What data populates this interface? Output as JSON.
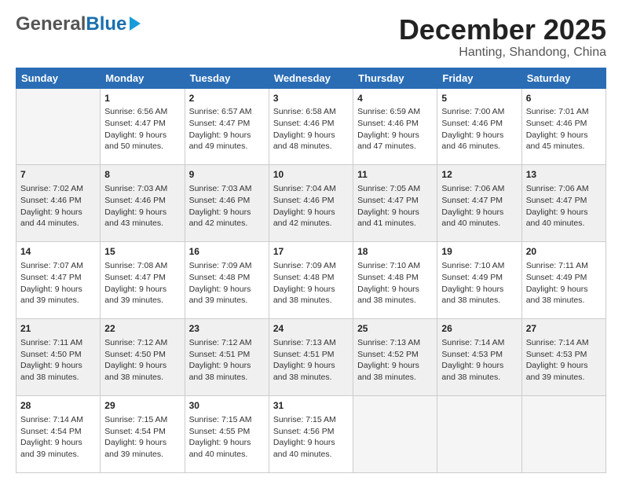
{
  "logo": {
    "general": "General",
    "blue": "Blue",
    "tagline": "GeneralBlue"
  },
  "header": {
    "month": "December 2025",
    "location": "Hanting, Shandong, China"
  },
  "days_of_week": [
    "Sunday",
    "Monday",
    "Tuesday",
    "Wednesday",
    "Thursday",
    "Friday",
    "Saturday"
  ],
  "weeks": [
    [
      {
        "day": "",
        "content": ""
      },
      {
        "day": "1",
        "content": "Sunrise: 6:56 AM\nSunset: 4:47 PM\nDaylight: 9 hours\nand 50 minutes."
      },
      {
        "day": "2",
        "content": "Sunrise: 6:57 AM\nSunset: 4:47 PM\nDaylight: 9 hours\nand 49 minutes."
      },
      {
        "day": "3",
        "content": "Sunrise: 6:58 AM\nSunset: 4:46 PM\nDaylight: 9 hours\nand 48 minutes."
      },
      {
        "day": "4",
        "content": "Sunrise: 6:59 AM\nSunset: 4:46 PM\nDaylight: 9 hours\nand 47 minutes."
      },
      {
        "day": "5",
        "content": "Sunrise: 7:00 AM\nSunset: 4:46 PM\nDaylight: 9 hours\nand 46 minutes."
      },
      {
        "day": "6",
        "content": "Sunrise: 7:01 AM\nSunset: 4:46 PM\nDaylight: 9 hours\nand 45 minutes."
      }
    ],
    [
      {
        "day": "7",
        "content": "Sunrise: 7:02 AM\nSunset: 4:46 PM\nDaylight: 9 hours\nand 44 minutes."
      },
      {
        "day": "8",
        "content": "Sunrise: 7:03 AM\nSunset: 4:46 PM\nDaylight: 9 hours\nand 43 minutes."
      },
      {
        "day": "9",
        "content": "Sunrise: 7:03 AM\nSunset: 4:46 PM\nDaylight: 9 hours\nand 42 minutes."
      },
      {
        "day": "10",
        "content": "Sunrise: 7:04 AM\nSunset: 4:46 PM\nDaylight: 9 hours\nand 42 minutes."
      },
      {
        "day": "11",
        "content": "Sunrise: 7:05 AM\nSunset: 4:47 PM\nDaylight: 9 hours\nand 41 minutes."
      },
      {
        "day": "12",
        "content": "Sunrise: 7:06 AM\nSunset: 4:47 PM\nDaylight: 9 hours\nand 40 minutes."
      },
      {
        "day": "13",
        "content": "Sunrise: 7:06 AM\nSunset: 4:47 PM\nDaylight: 9 hours\nand 40 minutes."
      }
    ],
    [
      {
        "day": "14",
        "content": "Sunrise: 7:07 AM\nSunset: 4:47 PM\nDaylight: 9 hours\nand 39 minutes."
      },
      {
        "day": "15",
        "content": "Sunrise: 7:08 AM\nSunset: 4:47 PM\nDaylight: 9 hours\nand 39 minutes."
      },
      {
        "day": "16",
        "content": "Sunrise: 7:09 AM\nSunset: 4:48 PM\nDaylight: 9 hours\nand 39 minutes."
      },
      {
        "day": "17",
        "content": "Sunrise: 7:09 AM\nSunset: 4:48 PM\nDaylight: 9 hours\nand 38 minutes."
      },
      {
        "day": "18",
        "content": "Sunrise: 7:10 AM\nSunset: 4:48 PM\nDaylight: 9 hours\nand 38 minutes."
      },
      {
        "day": "19",
        "content": "Sunrise: 7:10 AM\nSunset: 4:49 PM\nDaylight: 9 hours\nand 38 minutes."
      },
      {
        "day": "20",
        "content": "Sunrise: 7:11 AM\nSunset: 4:49 PM\nDaylight: 9 hours\nand 38 minutes."
      }
    ],
    [
      {
        "day": "21",
        "content": "Sunrise: 7:11 AM\nSunset: 4:50 PM\nDaylight: 9 hours\nand 38 minutes."
      },
      {
        "day": "22",
        "content": "Sunrise: 7:12 AM\nSunset: 4:50 PM\nDaylight: 9 hours\nand 38 minutes."
      },
      {
        "day": "23",
        "content": "Sunrise: 7:12 AM\nSunset: 4:51 PM\nDaylight: 9 hours\nand 38 minutes."
      },
      {
        "day": "24",
        "content": "Sunrise: 7:13 AM\nSunset: 4:51 PM\nDaylight: 9 hours\nand 38 minutes."
      },
      {
        "day": "25",
        "content": "Sunrise: 7:13 AM\nSunset: 4:52 PM\nDaylight: 9 hours\nand 38 minutes."
      },
      {
        "day": "26",
        "content": "Sunrise: 7:14 AM\nSunset: 4:53 PM\nDaylight: 9 hours\nand 38 minutes."
      },
      {
        "day": "27",
        "content": "Sunrise: 7:14 AM\nSunset: 4:53 PM\nDaylight: 9 hours\nand 39 minutes."
      }
    ],
    [
      {
        "day": "28",
        "content": "Sunrise: 7:14 AM\nSunset: 4:54 PM\nDaylight: 9 hours\nand 39 minutes."
      },
      {
        "day": "29",
        "content": "Sunrise: 7:15 AM\nSunset: 4:54 PM\nDaylight: 9 hours\nand 39 minutes."
      },
      {
        "day": "30",
        "content": "Sunrise: 7:15 AM\nSunset: 4:55 PM\nDaylight: 9 hours\nand 40 minutes."
      },
      {
        "day": "31",
        "content": "Sunrise: 7:15 AM\nSunset: 4:56 PM\nDaylight: 9 hours\nand 40 minutes."
      },
      {
        "day": "",
        "content": ""
      },
      {
        "day": "",
        "content": ""
      },
      {
        "day": "",
        "content": ""
      }
    ]
  ]
}
